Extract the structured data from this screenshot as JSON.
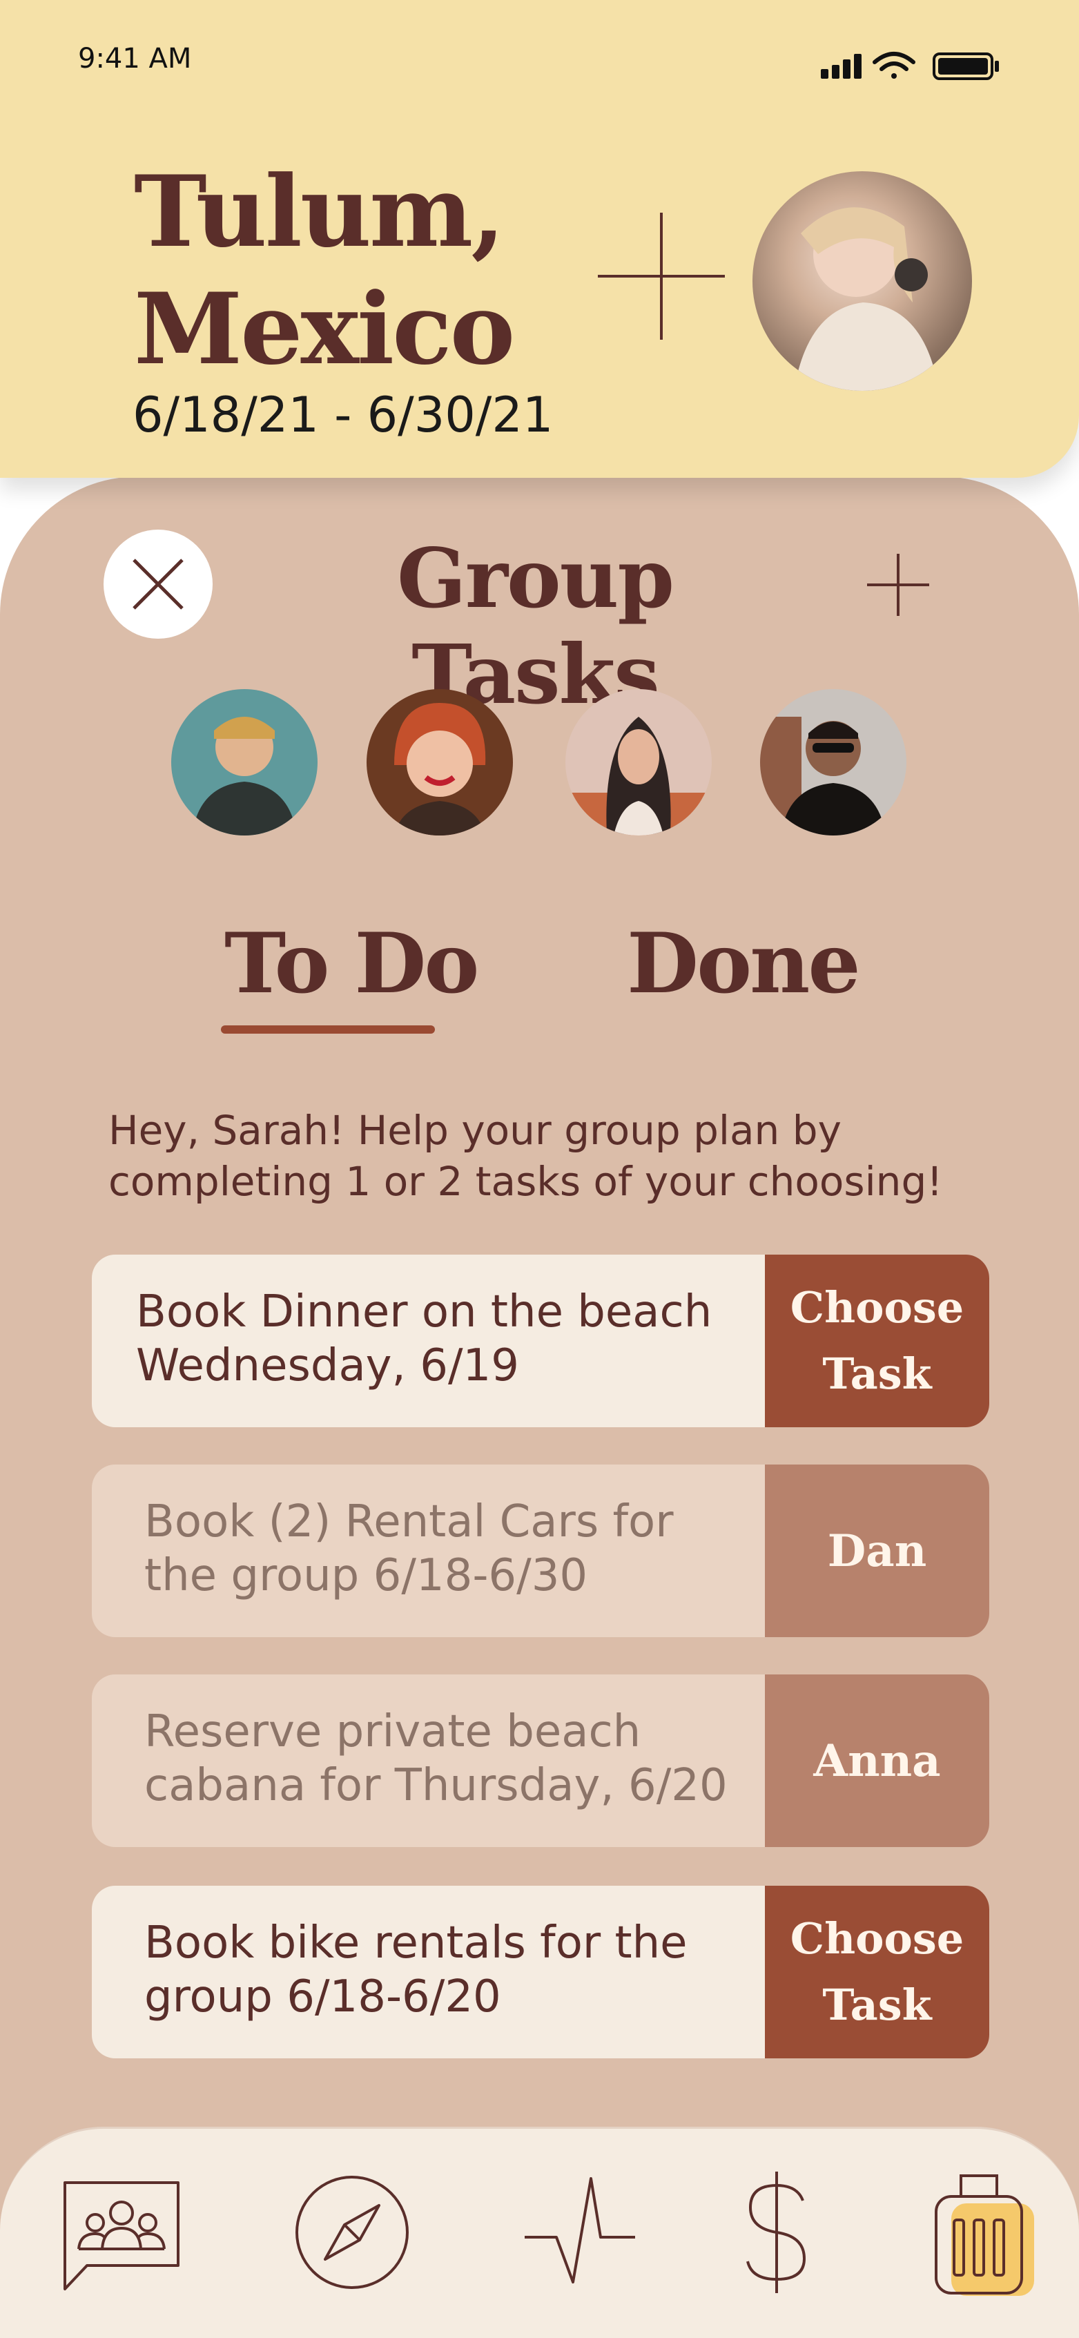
{
  "status_bar": {
    "time": "9:41 AM"
  },
  "trip": {
    "title": "Tulum, Mexico",
    "dates": "6/18/21 - 6/30/21"
  },
  "panel": {
    "title": "Group Tasks",
    "tabs": [
      {
        "label": "To Do",
        "active": true
      },
      {
        "label": "Done",
        "active": false
      }
    ],
    "intro": "Hey, Sarah! Help your group plan by completing 1 or 2 tasks of your choosing!"
  },
  "tasks": [
    {
      "line1": "Book Dinner on the beach",
      "line2": "Wednesday, 6/19",
      "action": "Choose Task",
      "status": "available"
    },
    {
      "line1": "Book (2) Rental Cars for",
      "line2": "the group 6/18-6/30",
      "action": "Dan",
      "status": "claimed"
    },
    {
      "line1": "Reserve private beach",
      "line2": "cabana for Thursday, 6/20",
      "action": "Anna",
      "status": "claimed"
    },
    {
      "line1": "Book bike rentals for the",
      "line2": "group 6/18-6/20",
      "action": "Choose Task",
      "status": "available"
    }
  ],
  "nav": {
    "items": [
      "group-chat-icon",
      "compass-icon",
      "activity-icon",
      "dollar-icon",
      "luggage-icon"
    ],
    "active": "luggage-icon"
  },
  "colors": {
    "header_bg": "#f5e1a8",
    "panel_bg": "#dbbda9",
    "brand_brown": "#5a2e2a",
    "accent_rust": "#9a4d35",
    "claimed": "#b7826c",
    "nav_bg": "#f5ece1",
    "active_nav": "#f5c96b"
  }
}
